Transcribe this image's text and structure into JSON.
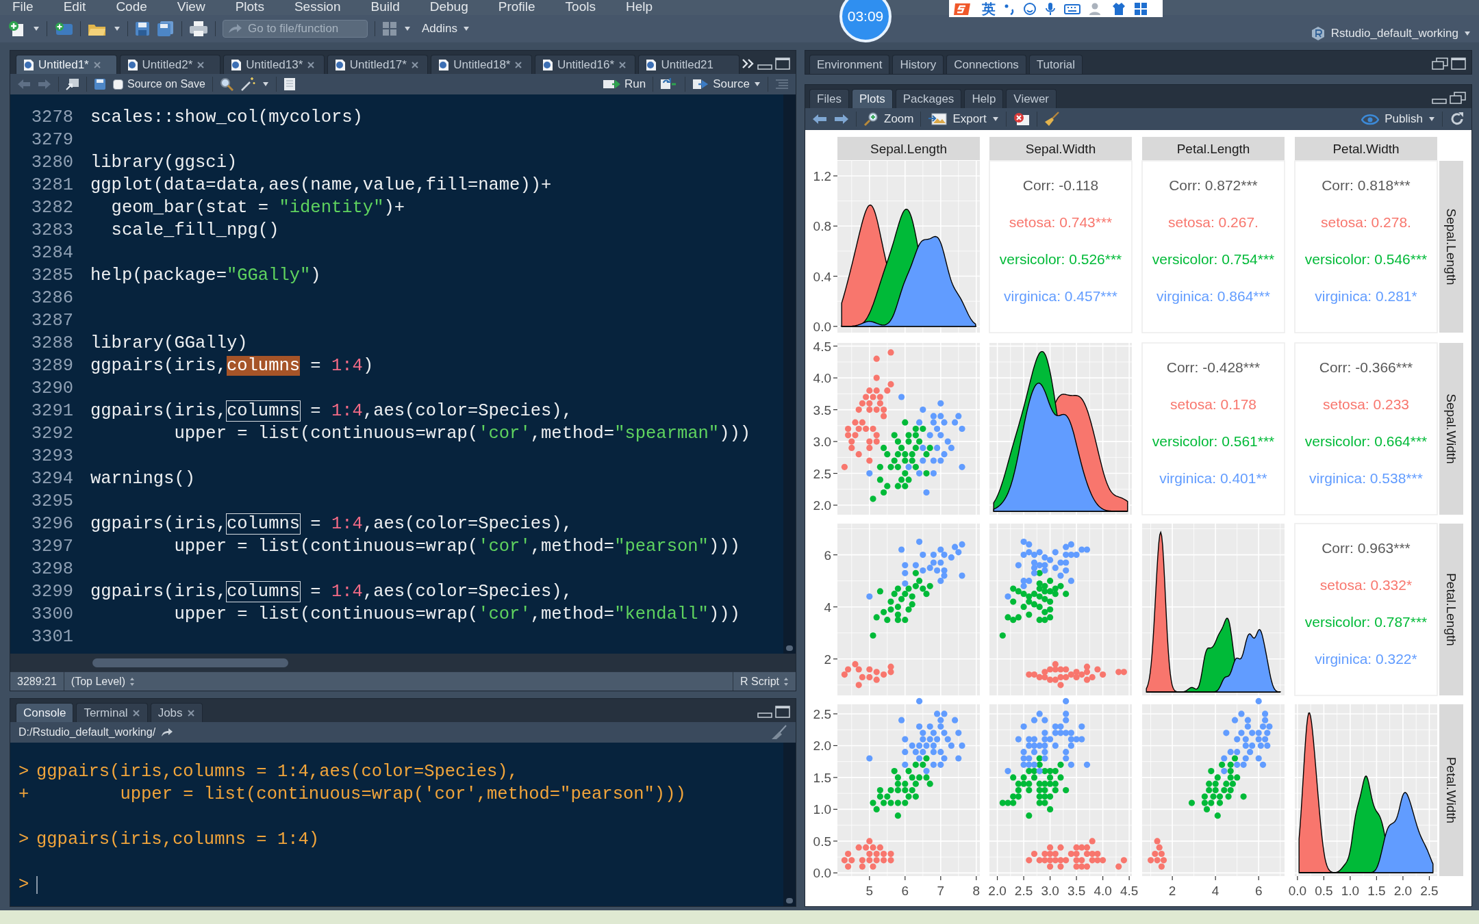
{
  "menu": [
    "File",
    "Edit",
    "Code",
    "View",
    "Plots",
    "Session",
    "Build",
    "Debug",
    "Profile",
    "Tools",
    "Help"
  ],
  "toolbar": {
    "goto_placeholder": "Go to file/function",
    "addins": "Addins",
    "project": "Rstudio_default_working"
  },
  "overlays": {
    "timer": "03:09",
    "ime_mode": "英"
  },
  "editor": {
    "tabs": [
      {
        "label": "Untitled1*",
        "selected": true
      },
      {
        "label": "Untitled2*",
        "selected": false
      },
      {
        "label": "Untitled13*",
        "selected": false
      },
      {
        "label": "Untitled17*",
        "selected": false
      },
      {
        "label": "Untitled18*",
        "selected": false
      },
      {
        "label": "Untitled16*",
        "selected": false
      },
      {
        "label": "Untitled21",
        "selected": false
      }
    ],
    "source_on_save": {
      "label": "Source on Save",
      "checked": false
    },
    "run": "Run",
    "source": "Source",
    "lines": [
      {
        "number": "3278",
        "tokens": [
          {
            "text": "scales::show_col(mycolors)",
            "kind": "plain"
          }
        ]
      },
      {
        "number": "3279"
      },
      {
        "number": "3280",
        "tokens": [
          {
            "text": "library(ggsci)",
            "kind": "plain"
          }
        ]
      },
      {
        "number": "3281",
        "tokens": [
          {
            "text": "ggplot(data=data,aes(name,value,fill=name))+",
            "kind": "plain"
          }
        ]
      },
      {
        "number": "3282",
        "tokens": [
          {
            "text": "  geom_bar(stat = ",
            "kind": "plain"
          },
          {
            "text": "\"identity\"",
            "kind": "string"
          },
          {
            "text": ")+",
            "kind": "plain"
          }
        ]
      },
      {
        "number": "3283",
        "tokens": [
          {
            "text": "  scale_fill_npg()",
            "kind": "plain"
          }
        ]
      },
      {
        "number": "3284"
      },
      {
        "number": "3285",
        "tokens": [
          {
            "text": "help(package=",
            "kind": "plain"
          },
          {
            "text": "\"GGally\"",
            "kind": "string"
          },
          {
            "text": ")",
            "kind": "plain"
          }
        ]
      },
      {
        "number": "3286"
      },
      {
        "number": "3287"
      },
      {
        "number": "3288",
        "tokens": [
          {
            "text": "library(GGally)",
            "kind": "plain"
          }
        ]
      },
      {
        "number": "3289",
        "tokens": [
          {
            "text": "ggpairs(iris,",
            "kind": "plain"
          },
          {
            "text": "columns",
            "kind": "selected"
          },
          {
            "text": " = ",
            "kind": "plain"
          },
          {
            "text": "1:4",
            "kind": "number"
          },
          {
            "text": ")",
            "kind": "plain"
          }
        ]
      },
      {
        "number": "3290"
      },
      {
        "number": "3291",
        "tokens": [
          {
            "text": "ggpairs(iris,",
            "kind": "plain"
          },
          {
            "text": "columns",
            "kind": "match"
          },
          {
            "text": " = ",
            "kind": "plain"
          },
          {
            "text": "1:4",
            "kind": "number"
          },
          {
            "text": ",aes(color=Species),",
            "kind": "plain"
          }
        ]
      },
      {
        "number": "3292",
        "tokens": [
          {
            "text": "        upper = list(continuous=wrap(",
            "kind": "plain"
          },
          {
            "text": "'cor'",
            "kind": "string"
          },
          {
            "text": ",method=",
            "kind": "plain"
          },
          {
            "text": "\"spearman\"",
            "kind": "string"
          },
          {
            "text": ")))",
            "kind": "plain"
          }
        ]
      },
      {
        "number": "3293"
      },
      {
        "number": "3294",
        "tokens": [
          {
            "text": "warnings()",
            "kind": "plain"
          }
        ]
      },
      {
        "number": "3295"
      },
      {
        "number": "3296",
        "tokens": [
          {
            "text": "ggpairs(iris,",
            "kind": "plain"
          },
          {
            "text": "columns",
            "kind": "match"
          },
          {
            "text": " = ",
            "kind": "plain"
          },
          {
            "text": "1:4",
            "kind": "number"
          },
          {
            "text": ",aes(color=Species),",
            "kind": "plain"
          }
        ]
      },
      {
        "number": "3297",
        "tokens": [
          {
            "text": "        upper = list(continuous=wrap(",
            "kind": "plain"
          },
          {
            "text": "'cor'",
            "kind": "string"
          },
          {
            "text": ",method=",
            "kind": "plain"
          },
          {
            "text": "\"pearson\"",
            "kind": "string"
          },
          {
            "text": ")))",
            "kind": "plain"
          }
        ]
      },
      {
        "number": "3298"
      },
      {
        "number": "3299",
        "tokens": [
          {
            "text": "ggpairs(iris,",
            "kind": "plain"
          },
          {
            "text": "columns",
            "kind": "match"
          },
          {
            "text": " = ",
            "kind": "plain"
          },
          {
            "text": "1:4",
            "kind": "number"
          },
          {
            "text": ",aes(color=Species),",
            "kind": "plain"
          }
        ]
      },
      {
        "number": "3300",
        "tokens": [
          {
            "text": "        upper = list(continuous=wrap(",
            "kind": "plain"
          },
          {
            "text": "'cor'",
            "kind": "string"
          },
          {
            "text": ",method=",
            "kind": "plain"
          },
          {
            "text": "\"kendall\"",
            "kind": "string"
          },
          {
            "text": ")))",
            "kind": "plain"
          }
        ]
      },
      {
        "number": "3301"
      }
    ],
    "status": {
      "position": "3289:21",
      "scope": "(Top Level)",
      "file_type": "R Script"
    }
  },
  "console": {
    "tabs": [
      {
        "label": "Console",
        "selected": true,
        "closable": false
      },
      {
        "label": "Terminal",
        "selected": false,
        "closable": true
      },
      {
        "label": "Jobs",
        "selected": false,
        "closable": true
      }
    ],
    "path": "D:/Rstudio_default_working/",
    "entries": [
      {
        "lines": [
          {
            "prompt": ">",
            "text": "ggpairs(iris,columns = 1:4,aes(color=Species),"
          },
          {
            "prompt": "+",
            "text": "        upper = list(continuous=wrap('cor',method=\"pearson\")))"
          }
        ]
      },
      {
        "lines": [
          {
            "prompt": ">",
            "text": "ggpairs(iris,columns = 1:4)"
          }
        ]
      },
      {
        "lines": [
          {
            "prompt": ">"
          }
        ]
      }
    ]
  },
  "upper_tabs": [
    {
      "label": "Environment",
      "selected": false
    },
    {
      "label": "History",
      "selected": false
    },
    {
      "label": "Connections",
      "selected": false
    },
    {
      "label": "Tutorial",
      "selected": false
    }
  ],
  "lower_tabs": [
    {
      "label": "Files",
      "selected": false
    },
    {
      "label": "Plots",
      "selected": true
    },
    {
      "label": "Packages",
      "selected": false
    },
    {
      "label": "Help",
      "selected": false
    },
    {
      "label": "Viewer",
      "selected": false
    }
  ],
  "plots_toolbar": {
    "zoom": "Zoom",
    "export": "Export",
    "publish": "Publish"
  },
  "plot": {
    "column_strips": [
      "Sepal.Length",
      "Sepal.Width",
      "Petal.Length",
      "Petal.Width"
    ],
    "row_strips": [
      "Sepal.Length",
      "Sepal.Width",
      "Petal.Length",
      "Petal.Width"
    ],
    "upper_panels": [
      {
        "lines": [
          {
            "text": "Corr: -0.118",
            "color": "#595959"
          },
          {
            "text": "setosa: 0.743***",
            "color": "#f8766d"
          },
          {
            "text": "versicolor: 0.526***",
            "color": "#00ba38"
          },
          {
            "text": "virginica: 0.457***",
            "color": "#619cff"
          }
        ]
      },
      {
        "lines": [
          {
            "text": "Corr: 0.872***",
            "color": "#595959"
          },
          {
            "text": "setosa: 0.267.",
            "color": "#f8766d"
          },
          {
            "text": "versicolor: 0.754***",
            "color": "#00ba38"
          },
          {
            "text": "virginica: 0.864***",
            "color": "#619cff"
          }
        ]
      },
      {
        "lines": [
          {
            "text": "Corr: 0.818***",
            "color": "#595959"
          },
          {
            "text": "setosa: 0.278.",
            "color": "#f8766d"
          },
          {
            "text": "versicolor: 0.546***",
            "color": "#00ba38"
          },
          {
            "text": "virginica: 0.281*",
            "color": "#619cff"
          }
        ]
      },
      {
        "lines": [
          {
            "text": "Corr: -0.428***",
            "color": "#595959"
          },
          {
            "text": "setosa: 0.178",
            "color": "#f8766d"
          },
          {
            "text": "versicolor: 0.561***",
            "color": "#00ba38"
          },
          {
            "text": "virginica: 0.401**",
            "color": "#619cff"
          }
        ]
      },
      {
        "lines": [
          {
            "text": "Corr: -0.366***",
            "color": "#595959"
          },
          {
            "text": "setosa: 0.233",
            "color": "#f8766d"
          },
          {
            "text": "versicolor: 0.664***",
            "color": "#00ba38"
          },
          {
            "text": "virginica: 0.538***",
            "color": "#619cff"
          }
        ]
      },
      {
        "lines": [
          {
            "text": "Corr: 0.963***",
            "color": "#595959"
          },
          {
            "text": "setosa: 0.332*",
            "color": "#f8766d"
          },
          {
            "text": "versicolor: 0.787***",
            "color": "#00ba38"
          },
          {
            "text": "virginica: 0.322*",
            "color": "#619cff"
          }
        ]
      }
    ],
    "y_ticks": [
      [
        "1.2",
        "0.8",
        "0.4",
        "0.0"
      ],
      [
        "4.5",
        "4.0",
        "3.5",
        "3.0",
        "2.5",
        "2.0"
      ],
      [
        "6",
        "4",
        "2"
      ],
      [
        "2.5",
        "2.0",
        "1.5",
        "1.0",
        "0.5",
        "0.0"
      ]
    ],
    "x_ticks": [
      [
        "5",
        "6",
        "7",
        "8"
      ],
      [
        "2.0",
        "2.5",
        "3.0",
        "3.5",
        "4.0",
        "4.5"
      ],
      [
        "2",
        "4",
        "6"
      ],
      [
        "0.0",
        "0.5",
        "1.0",
        "1.5",
        "2.0",
        "2.5"
      ]
    ]
  }
}
